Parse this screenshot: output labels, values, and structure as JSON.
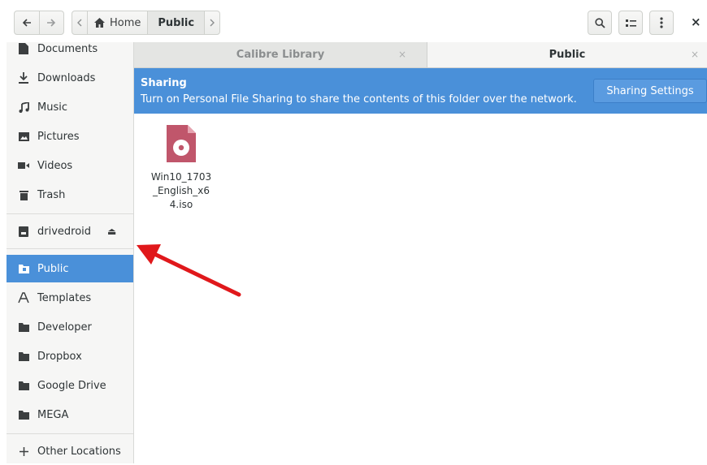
{
  "header": {
    "back_icon": "arrow-left-icon",
    "forward_icon": "arrow-right-icon",
    "path": {
      "home_label": "Home",
      "current_label": "Public"
    },
    "search_icon": "search-icon",
    "view_icon": "list-view-icon",
    "menu_icon": "kebab-menu-icon",
    "close_label": "×"
  },
  "sidebar": {
    "items": [
      {
        "label": "Documents",
        "icon": "document-icon"
      },
      {
        "label": "Downloads",
        "icon": "download-icon"
      },
      {
        "label": "Music",
        "icon": "music-icon"
      },
      {
        "label": "Pictures",
        "icon": "picture-icon"
      },
      {
        "label": "Videos",
        "icon": "video-icon"
      },
      {
        "label": "Trash",
        "icon": "trash-icon"
      },
      {
        "label": "drivedroid",
        "icon": "drive-icon"
      },
      {
        "label": "Public",
        "icon": "folder-public-icon"
      },
      {
        "label": "Templates",
        "icon": "templates-icon"
      },
      {
        "label": "Developer",
        "icon": "folder-icon"
      },
      {
        "label": "Dropbox",
        "icon": "folder-icon"
      },
      {
        "label": "Google Drive",
        "icon": "folder-icon"
      },
      {
        "label": "MEGA",
        "icon": "folder-icon"
      },
      {
        "label": "Other Locations",
        "icon": "plus-icon"
      }
    ],
    "active_item": "Public"
  },
  "tabs": [
    {
      "label": "Calibre Library",
      "active": false
    },
    {
      "label": "Public",
      "active": true
    }
  ],
  "infobar": {
    "title": "Sharing",
    "message": "Turn on Personal File Sharing to share the contents of this folder over the network.",
    "button_label": "Sharing Settings"
  },
  "files": [
    {
      "name": "Win10_1703_English_x64.iso",
      "icon": "disc-image-icon"
    }
  ],
  "colors": {
    "accent": "#4a90d9",
    "file_icon": "#c0566b",
    "annotation_arrow": "#e0181b"
  }
}
